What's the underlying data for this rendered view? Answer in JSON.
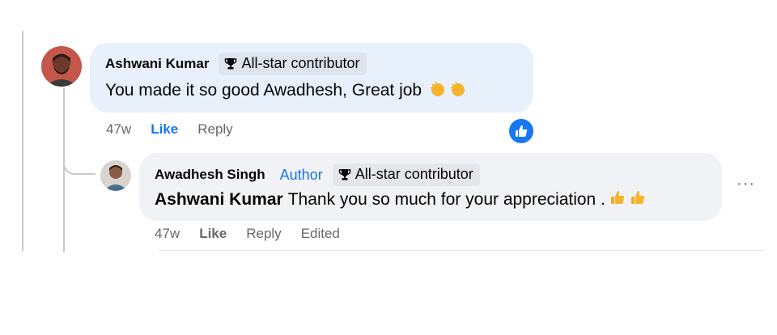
{
  "comment": {
    "author": "Ashwani Kumar",
    "badge": "All-star contributor",
    "text": "You made it so good Awadhesh, Great job",
    "emojis": [
      "clap-emoji",
      "clap-emoji"
    ],
    "time": "47w",
    "like_label": "Like",
    "reply_label": "Reply",
    "reaction_icon": "like-reaction-icon"
  },
  "reply": {
    "author": "Awadhesh Singh",
    "author_tag": "Author",
    "badge": "All-star contributor",
    "mention": "Ashwani Kumar",
    "text": "Thank you so much for your appreciation .",
    "emojis": [
      "thumbs-up-emoji",
      "thumbs-up-emoji"
    ],
    "time": "47w",
    "like_label": "Like",
    "reply_label": "Reply",
    "edited_label": "Edited",
    "more_label": "···"
  },
  "colors": {
    "link_blue": "#1877f2",
    "author_blue": "#1b74e4",
    "bubble_gray": "#f0f2f5",
    "bubble_highlight": "#e7f0fb",
    "meta_gray": "#65676b"
  }
}
